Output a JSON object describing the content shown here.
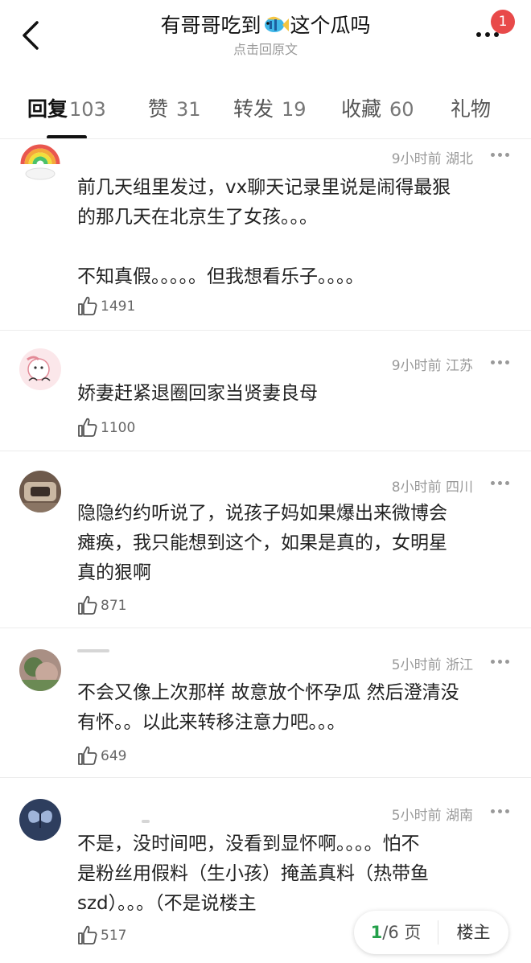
{
  "header": {
    "title_prefix": "有哥哥吃到",
    "title_suffix": "这个瓜吗",
    "subtitle": "点击回原文",
    "badge_count": "1"
  },
  "tabs": [
    {
      "label": "回复",
      "count": "103",
      "active": true
    },
    {
      "label": "赞",
      "count": "31",
      "active": false
    },
    {
      "label": "转发",
      "count": "19",
      "active": false
    },
    {
      "label": "收藏",
      "count": "60",
      "active": false
    },
    {
      "label": "礼物",
      "count": "",
      "active": false
    }
  ],
  "comments": [
    {
      "time": "9小时前",
      "location": "湖北",
      "lines": [
        "前几天组里发过，vx聊天记录里说是闹得最狠",
        "的那几天在北京生了女孩。。。",
        "",
        "不知真假。。。。。但我想看乐子。。。。"
      ],
      "likes": "1491"
    },
    {
      "time": "9小时前",
      "location": "江苏",
      "lines": [
        "娇妻赶紧退圈回家当贤妻良母"
      ],
      "likes": "1100"
    },
    {
      "time": "8小时前",
      "location": "四川",
      "lines": [
        "隐隐约约听说了，说孩子妈如果爆出来微博会",
        "瘫痪，我只能想到这个，如果是真的，女明星",
        "真的狠啊"
      ],
      "likes": "871"
    },
    {
      "time": "5小时前",
      "location": "浙江",
      "lines": [
        "不会又像上次那样 故意放个怀孕瓜 然后澄清没",
        "有怀。。以此来转移注意力吧。。。"
      ],
      "likes": "649"
    },
    {
      "time": "5小时前",
      "location": "湖南",
      "lines": [
        "不是，没时间吧，没看到显怀啊。。。。怕不",
        "是粉丝用假料（生小孩）掩盖真料（热带鱼",
        "szd）。。。（不是说楼主"
      ],
      "likes": "517"
    }
  ],
  "pager": {
    "current": "1",
    "total_label": "/6 页",
    "floor_label": "楼主"
  },
  "colors": {
    "accent_green": "#23a04a",
    "badge_red": "#e84a4a",
    "meta_gray": "#9a9a9a"
  },
  "icons": [
    "back-arrow-icon",
    "fish-emoji-icon",
    "more-dots-icon",
    "thumbs-up-icon",
    "comment-more-icon"
  ]
}
